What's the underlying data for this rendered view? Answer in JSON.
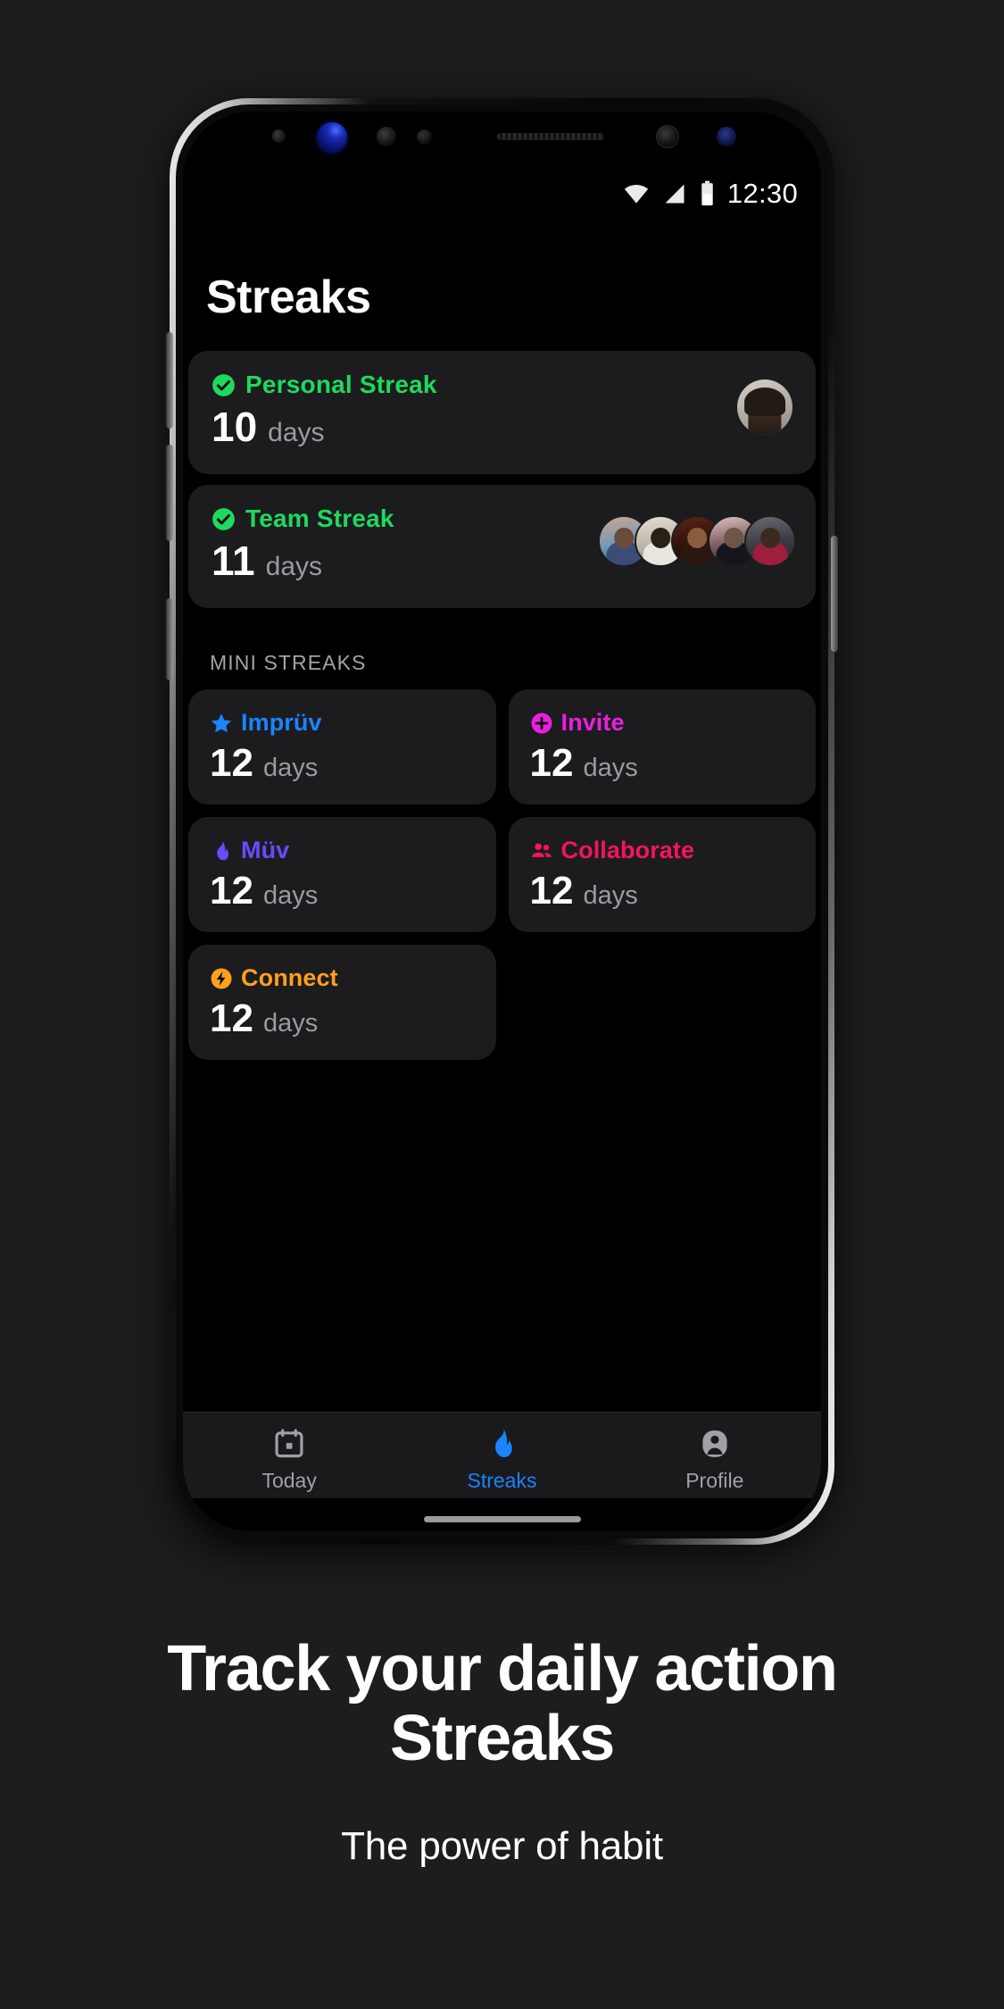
{
  "statusbar": {
    "time": "12:30",
    "icons": [
      "wifi-icon",
      "cellular-signal-icon",
      "battery-icon"
    ]
  },
  "app": {
    "title": "Streaks"
  },
  "big_streaks": [
    {
      "icon": "check-circle-icon",
      "label": "Personal Streak",
      "count": "10",
      "unit": "days",
      "accent": "#1ED95E",
      "avatars": 1
    },
    {
      "icon": "check-circle-icon",
      "label": "Team Streak",
      "count": "11",
      "unit": "days",
      "accent": "#1ED95E",
      "avatars": 5
    }
  ],
  "mini_section": {
    "label": "MINI STREAKS",
    "items": [
      {
        "icon": "star-icon",
        "label": "Imprüv",
        "count": "12",
        "unit": "days",
        "accent": "#1A84FF"
      },
      {
        "icon": "plus-circle-icon",
        "label": "Invite",
        "count": "12",
        "unit": "days",
        "accent": "#E91FE0"
      },
      {
        "icon": "flame-icon",
        "label": "Müv",
        "count": "12",
        "unit": "days",
        "accent": "#6A4BFF"
      },
      {
        "icon": "people-icon",
        "label": "Collaborate",
        "count": "12",
        "unit": "days",
        "accent": "#F5145E"
      },
      {
        "icon": "bolt-circle-icon",
        "label": "Connect",
        "count": "12",
        "unit": "days",
        "accent": "#FFA01E"
      }
    ]
  },
  "tabbar": {
    "tabs": [
      {
        "icon": "calendar-icon",
        "label": "Today",
        "active": false
      },
      {
        "icon": "flame-icon",
        "label": "Streaks",
        "active": true
      },
      {
        "icon": "person-icon",
        "label": "Profile",
        "active": false
      }
    ],
    "active_color": "#1A84FF",
    "inactive_color": "#A0A0A5"
  },
  "caption": {
    "headline_line1": "Track your daily action",
    "headline_line2": "Streaks",
    "subhead": "The power of habit"
  }
}
